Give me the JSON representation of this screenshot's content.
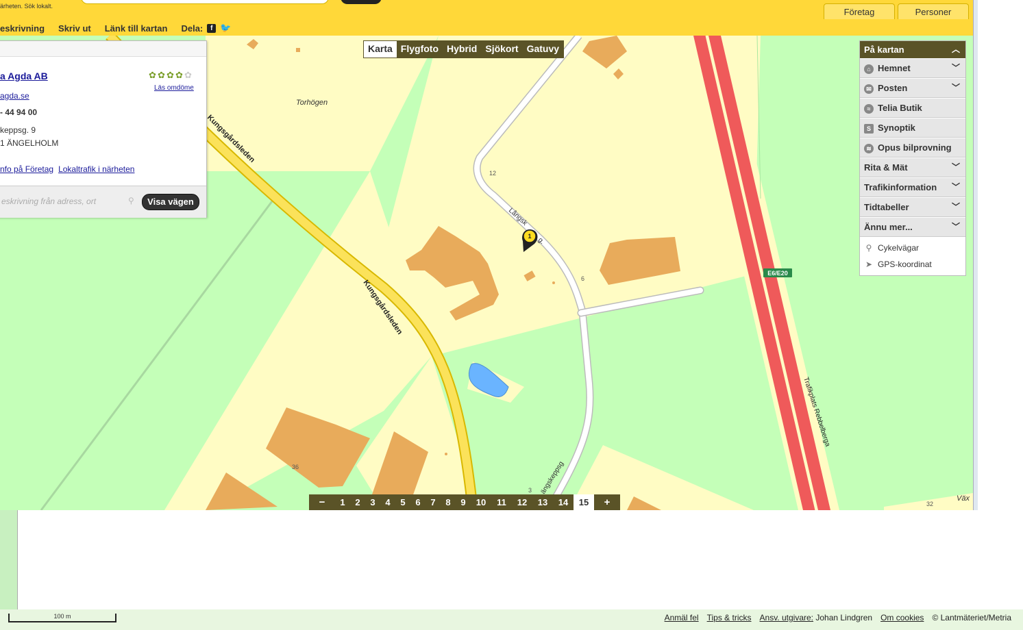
{
  "header": {
    "slogan": "ärheten. Sök lokalt.",
    "tabs": [
      "Företag",
      "Personer"
    ],
    "toolbar": {
      "description": "eskrivning",
      "print": "Skriv ut",
      "link": "Länk till kartan",
      "share": "Dela:"
    }
  },
  "maptypes": [
    "Karta",
    "Flygfoto",
    "Hybrid",
    "Sjökort",
    "Gatuvy"
  ],
  "maptype_active": "Karta",
  "info": {
    "company": "a Agda AB",
    "rating": 4,
    "rating_max": 5,
    "review_link": "Läs omdöme",
    "website": "agda.se",
    "phone": "- 44 94 00",
    "address_line1": "keppsg. 9",
    "address_line2": "1 ÄNGELHOLM",
    "link_info": "nfo på Företag",
    "link_transit": "Lokaltrafik i närheten",
    "route_placeholder": "eskrivning från adress, ort",
    "route_button": "Visa vägen"
  },
  "onmap": {
    "title": "På kartan",
    "items": [
      {
        "label": "Hemnet",
        "icon": "house-icon",
        "expandable": true
      },
      {
        "label": "Posten",
        "icon": "post-icon",
        "expandable": true
      },
      {
        "label": "Telia Butik",
        "icon": "telia-icon",
        "expandable": false
      },
      {
        "label": "Synoptik",
        "icon": "synoptik-icon",
        "expandable": false
      },
      {
        "label": "Opus bilprovning",
        "icon": "opus-icon",
        "expandable": false
      },
      {
        "label": "Rita & Mät",
        "icon": "",
        "expandable": true
      },
      {
        "label": "Trafikinformation",
        "icon": "",
        "expandable": true
      },
      {
        "label": "Tidtabeller",
        "icon": "",
        "expandable": true
      },
      {
        "label": "Ännu mer...",
        "icon": "",
        "expandable": true
      }
    ],
    "extras": [
      {
        "label": "Cykelvägar",
        "icon": "bicycle-icon"
      },
      {
        "label": "GPS-koordinat",
        "icon": "gps-arrow-icon"
      }
    ]
  },
  "map_labels": {
    "road1": "Kungsgårdsleden",
    "road1b": "Kungsgårdsleden",
    "street_a": "Långsk",
    "street_a2": "g.",
    "street_b": "ängskeppsg",
    "place": "Torhögen",
    "highway_shield": "E6/E20",
    "interchange": "Trafikplats Rebbelberga",
    "corner": "Väx",
    "num_12": "12",
    "num_6": "6",
    "num_36": "36",
    "num_3": "3",
    "num_32": "32",
    "marker": "1"
  },
  "zoom": {
    "minus": "−",
    "plus": "+",
    "levels": [
      "1",
      "2",
      "3",
      "4",
      "5",
      "6",
      "7",
      "8",
      "9",
      "10",
      "11",
      "12",
      "13",
      "14",
      "15"
    ],
    "active": "15"
  },
  "footer": {
    "scale": "100 m",
    "report": "Anmäl fel",
    "tips": "Tips & tricks",
    "publisher_label": "Ansv. utgivare:",
    "publisher": "Johan Lindgren",
    "cookies": "Om cookies",
    "copyright": "© Lantmäteriet/Metria"
  },
  "colors": {
    "header_yellow": "#ffd839",
    "panel_dark": "#5a5327",
    "grass": "#c4ffb8",
    "residential": "#fffcc4",
    "building": "#e8ab5b",
    "highway": "#ef5a5a",
    "main_road": "#fbe25a",
    "water": "#6ab4ff"
  }
}
